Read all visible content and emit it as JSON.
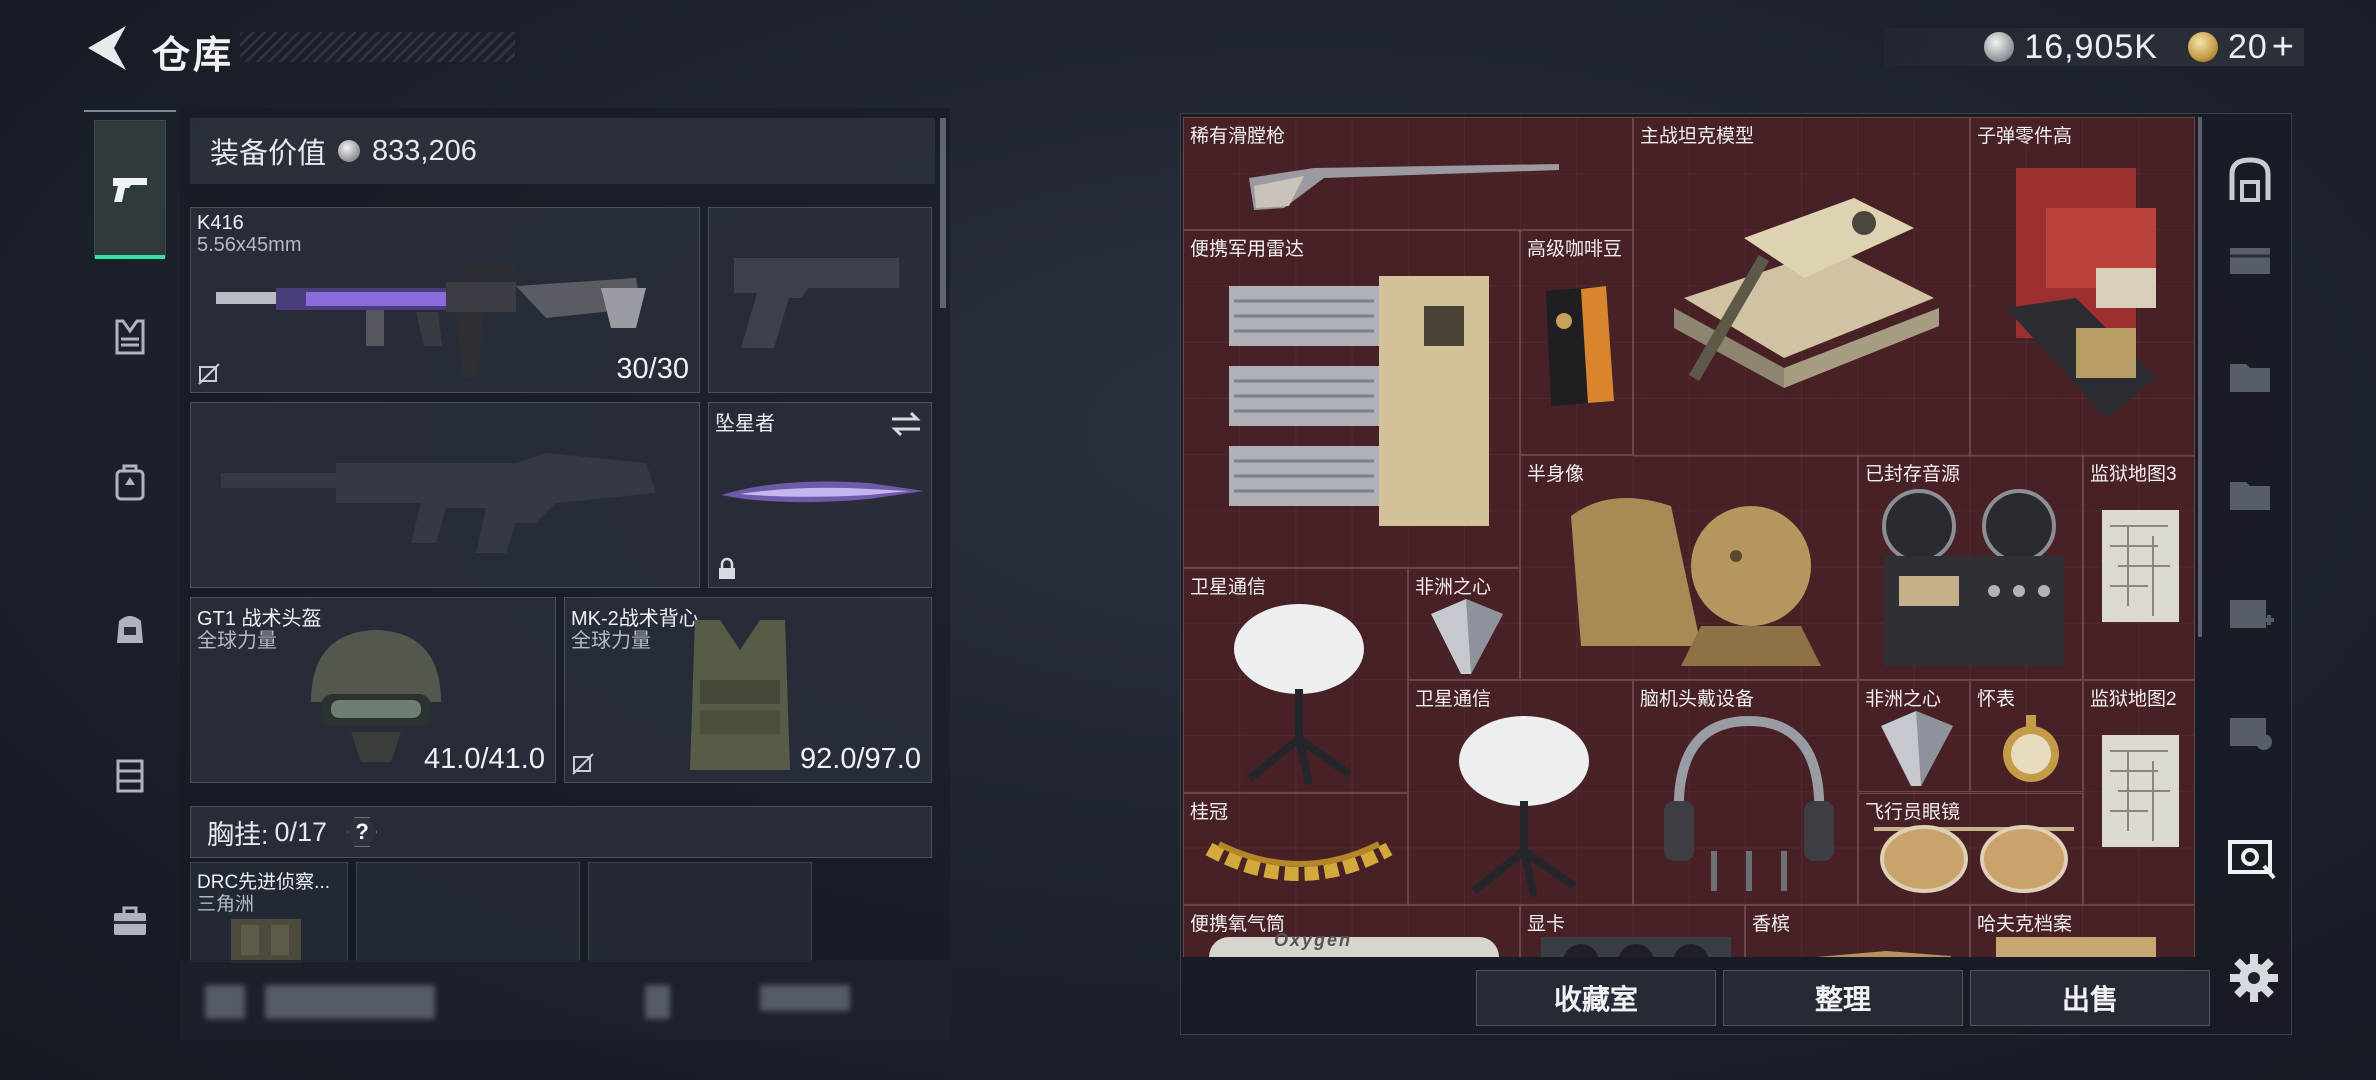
{
  "header": {
    "title": "仓库"
  },
  "currency": {
    "silver": "16,905K",
    "gold": "20",
    "gold_plus": "+"
  },
  "loadout": {
    "equip_value_label": "装备价值",
    "equip_value": "833,206",
    "primary": {
      "name": "K416",
      "ammo_type": "5.56x45mm",
      "ammo": "30/30"
    },
    "melee": {
      "name": "坠星者"
    },
    "helmet": {
      "name": "GT1 战术头盔",
      "faction": "全球力量",
      "durability": "41.0/41.0"
    },
    "vest": {
      "name": "MK-2战术背心",
      "faction": "全球力量",
      "durability": "92.0/97.0"
    },
    "chest_rig": {
      "label": "胸挂:",
      "count": "0/17",
      "help": "?"
    },
    "rig_slot": {
      "name": "DRC先进侦察...",
      "faction": "三角洲"
    }
  },
  "storage_items": [
    {
      "key": "rare_musket",
      "name": "稀有滑膛枪"
    },
    {
      "key": "tank_model",
      "name": "主战坦克模型"
    },
    {
      "key": "bullet_parts",
      "name": "子弹零件高"
    },
    {
      "key": "radar",
      "name": "便携军用雷达"
    },
    {
      "key": "coffee",
      "name": "高级咖啡豆"
    },
    {
      "key": "bust",
      "name": "半身像"
    },
    {
      "key": "tape",
      "name": "已封存音源"
    },
    {
      "key": "map3",
      "name": "监狱地图3"
    },
    {
      "key": "satcom1",
      "name": "卫星通信"
    },
    {
      "key": "heart1",
      "name": "非洲之心"
    },
    {
      "key": "satcom2",
      "name": "卫星通信"
    },
    {
      "key": "headset",
      "name": "脑机头戴设备"
    },
    {
      "key": "heart2",
      "name": "非洲之心"
    },
    {
      "key": "watch",
      "name": "怀表"
    },
    {
      "key": "map2",
      "name": "监狱地图2"
    },
    {
      "key": "laurel",
      "name": "桂冠"
    },
    {
      "key": "goggles",
      "name": "飞行员眼镜"
    },
    {
      "key": "oxygen",
      "name": "便携氧气筒"
    },
    {
      "key": "gpu",
      "name": "显卡"
    },
    {
      "key": "cotton",
      "name": "香槟"
    },
    {
      "key": "havk",
      "name": "哈夫克档案"
    }
  ],
  "oxygen_text": "Oxygen",
  "buttons": {
    "collection": "收藏室",
    "organize": "整理",
    "sell": "出售"
  },
  "colors": {
    "accent": "#34e2a3",
    "grid_bg": "#4a2327"
  },
  "icons": {
    "left_nav": [
      "pistol-icon",
      "vest-icon",
      "backpack-icon",
      "bag-icon",
      "rig-icon",
      "briefcase-icon"
    ],
    "right_tabs": [
      "safe-icon",
      "case-icon-1",
      "case-icon-2",
      "case-icon-3",
      "case-icon-4",
      "case-icon-5",
      "scan-icon"
    ]
  }
}
